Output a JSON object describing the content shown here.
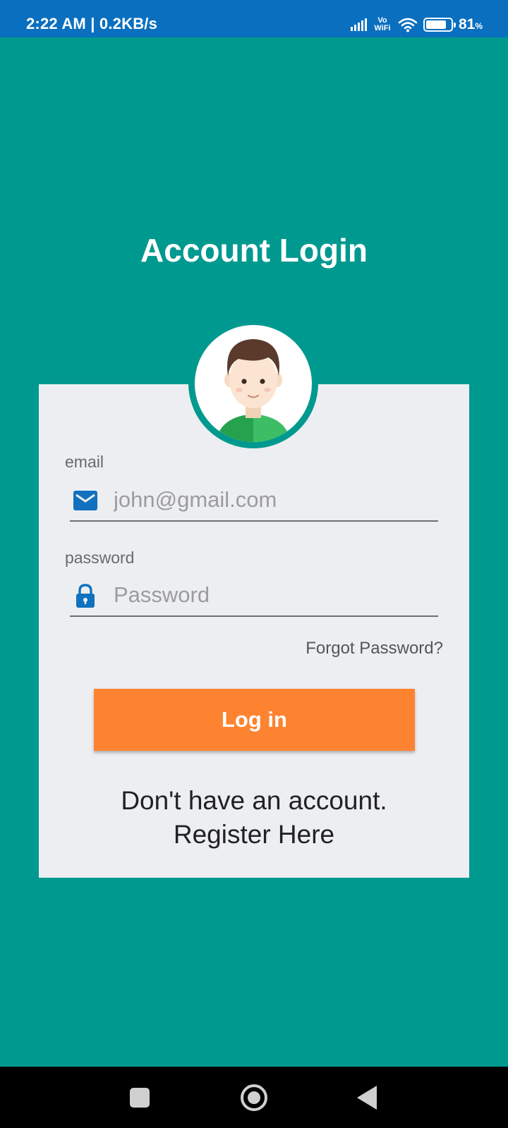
{
  "status_bar": {
    "time": "2:22 AM | 0.2KB/s",
    "network_type": "Vo WiFi",
    "battery_percent": "81",
    "battery_unit": "%",
    "battery_level": 0.81
  },
  "page": {
    "title": "Account Login",
    "background_color": "#00998F",
    "card_color": "#ECEEF1"
  },
  "form": {
    "email": {
      "label": "email",
      "placeholder": "john@gmail.com",
      "value": "",
      "icon": "mail-icon"
    },
    "password": {
      "label": "password",
      "placeholder": "Password",
      "value": "",
      "icon": "lock-icon"
    },
    "forgot_link": "Forgot Password?",
    "login_button": "Log in",
    "login_button_color": "#FE8331",
    "register_line1": "Don't have an account.",
    "register_line2": "Register Here"
  },
  "nav_bar": {
    "items": [
      "recents-button",
      "home-button",
      "back-button"
    ]
  }
}
